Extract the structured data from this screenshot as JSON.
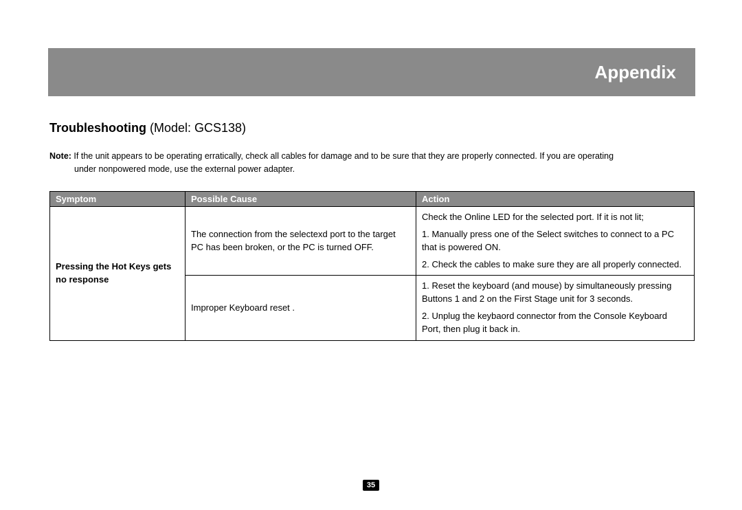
{
  "header": {
    "title": "Appendix"
  },
  "subtitle": {
    "bold": "Troubleshooting",
    "rest": " (Model: GCS138)"
  },
  "note": {
    "label": "Note:",
    "line1": " If the unit appears to be operating erratically, check all cables for damage and to be sure that they are properly connected.  If you are operating",
    "line2": "under nonpowered mode, use the external power adapter."
  },
  "table": {
    "headers": {
      "c1": "Symptom",
      "c2": "Possible Cause",
      "c3": "Action"
    },
    "row1": {
      "symptom": "Pressing the Hot Keys gets no response",
      "cause": "The connection from the selectexd port to the target PC has been broken, or the PC is turned OFF.",
      "action_p1": "Check the Online LED for the selected port.  If it is not lit;",
      "action_p2": "1. Manually press one of the Select switches to connect to a PC that is powered ON.",
      "action_p3": "2. Check the cables to make sure they are all properly connected."
    },
    "row2": {
      "cause": "Improper Keyboard reset .",
      "action_p1": "1. Reset the keyboard (and mouse) by simultaneously pressing Buttons 1 and 2 on the First Stage unit for 3 seconds.",
      "action_p2": "2. Unplug the keybaord connector from the Console Keyboard Port, then plug it back in."
    }
  },
  "page_number": "35"
}
